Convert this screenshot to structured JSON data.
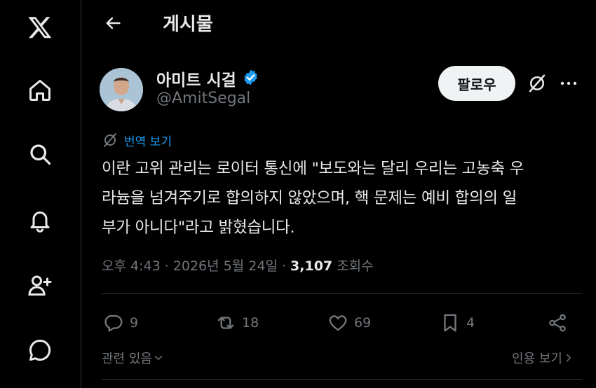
{
  "header": {
    "title": "게시물"
  },
  "author": {
    "name": "아미트 시걸",
    "handle": "@AmitSegal",
    "verified": true
  },
  "follow_label": "팔로우",
  "translate_label": "번역 보기",
  "tweet": {
    "lines": [
      "이란 고위 관리는 로이터 통신에 \"보도와는 달리 우리는 고농축 우",
      "라늄을 넘겨주기로 합의하지 않았으며, 핵 문제는 예비 합의의 일",
      "부가 아니다\"라고 밝혔습니다."
    ]
  },
  "meta": {
    "timestamp": "오후 4:43 · 2026년 5월 24일 · ",
    "views_count": "3,107",
    "views_label": " 조회수"
  },
  "actions": {
    "replies": "9",
    "reposts": "18",
    "likes": "69",
    "bookmarks": "4"
  },
  "footer": {
    "related": "관련 있음",
    "quotes": "인용 보기"
  },
  "colors": {
    "accent": "#1d9bf0",
    "background": "#000000",
    "muted": "#71767b",
    "text": "#e7e9ea"
  }
}
